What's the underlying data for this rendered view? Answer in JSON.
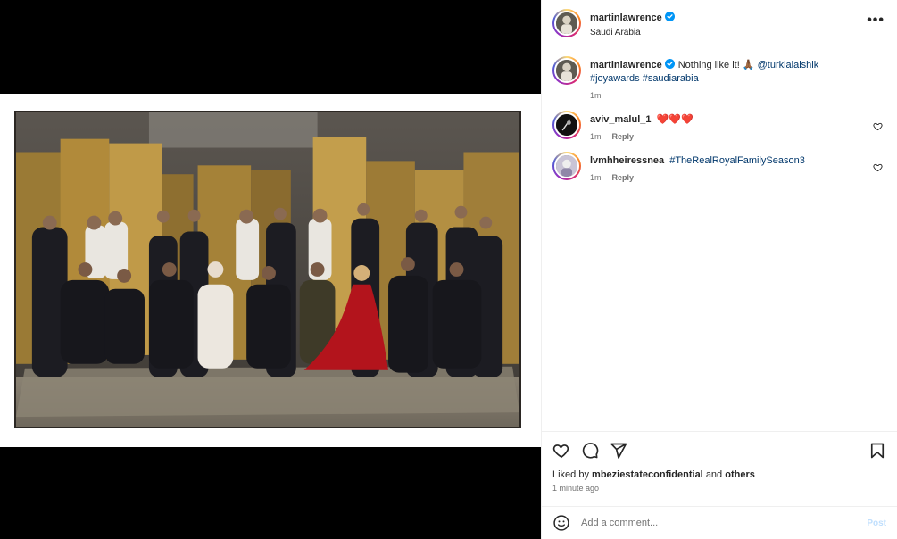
{
  "post": {
    "username": "martinlawrence",
    "location": "Saudi Arabia",
    "more_label": "•••"
  },
  "caption": {
    "username": "martinlawrence",
    "text": "Nothing like it! 🙏🏾",
    "mention": "@turkialalshik",
    "hashtags": "#joyawards #saudiarabia",
    "time": "1m"
  },
  "comments": [
    {
      "username": "aviv_malul_1",
      "text": "❤️❤️❤️",
      "time": "1m",
      "reply": "Reply"
    },
    {
      "username": "lvmhheiressnea",
      "text": "#TheRealRoyalFamilySeason3",
      "time": "1m",
      "reply": "Reply"
    }
  ],
  "likes": {
    "prefix": "Liked by",
    "user": "mbeziestateconfidential",
    "and": "and",
    "others": "others",
    "time": "1 minute ago"
  },
  "add_comment": {
    "placeholder": "Add a comment...",
    "post_label": "Post"
  },
  "icons": {
    "verified": "verified-badge-icon",
    "like": "heart-icon",
    "comment": "comment-bubble-icon",
    "share": "paper-plane-icon",
    "save": "bookmark-icon",
    "emoji": "smiley-icon"
  },
  "colors": {
    "verified": "#0095f6",
    "link": "#00376b",
    "heart": "#e0243a",
    "post_button_disabled": "#c0dffd"
  }
}
